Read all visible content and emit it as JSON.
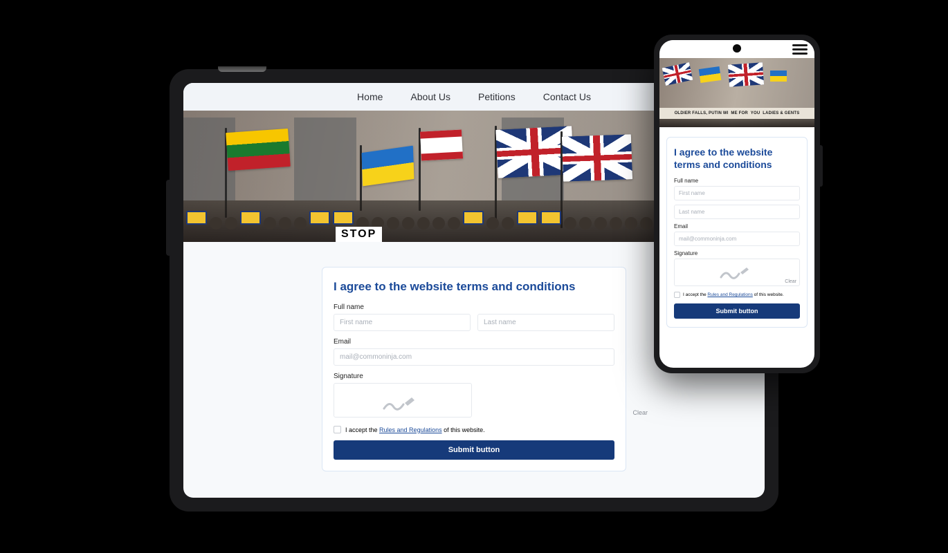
{
  "nav": {
    "home": "Home",
    "about": "About Us",
    "petitions": "Petitions",
    "contact": "Contact Us"
  },
  "hero": {
    "stop_sign": "STOP",
    "phone_banner_prefix": "OLDIER FALLS, PUTIN WI",
    "phone_banner_mid": "ME FOR",
    "phone_banner_you": "YOU",
    "phone_banner_suffix": "LADIES & GENTS"
  },
  "form": {
    "title": "I agree to the website terms and conditions",
    "labels": {
      "fullname": "Full name",
      "email": "Email",
      "signature": "Signature"
    },
    "placeholders": {
      "first": "First name",
      "last": "Last name",
      "email": "mail@commoninja.com"
    },
    "clear": "Clear",
    "accept_prefix": "I accept the ",
    "accept_link": "Rules and Regulations",
    "accept_suffix": " of this website.",
    "submit": "Submit button"
  }
}
